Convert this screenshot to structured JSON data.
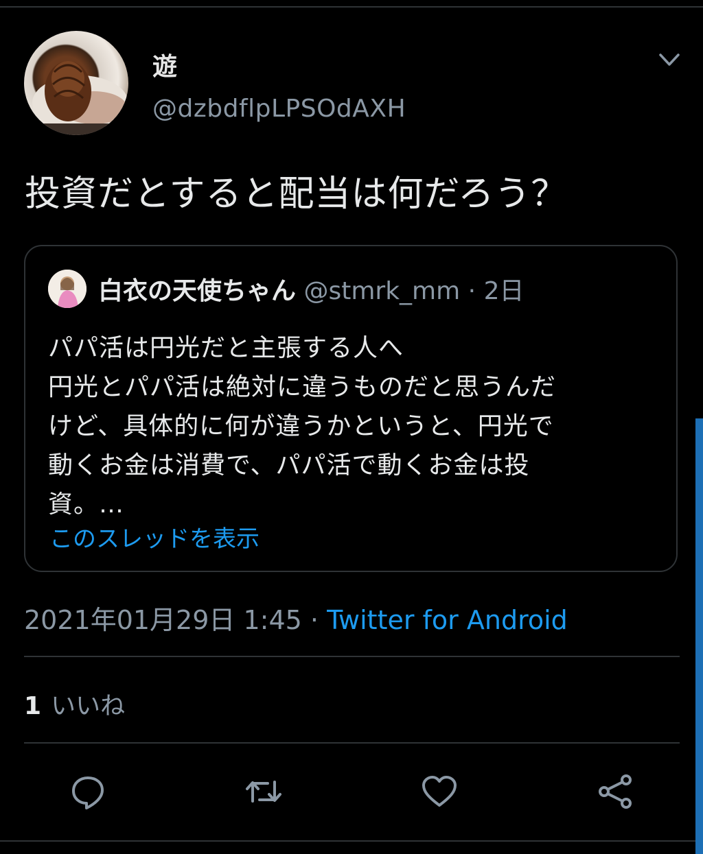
{
  "tweet": {
    "author": {
      "display_name": "遊",
      "handle": "@dzbdflpLPSOdAXH",
      "avatar_icon": "mont-blanc-cake-avatar"
    },
    "text": "投資だとすると配当は何だろう？",
    "quoted": {
      "author": {
        "display_name": "白衣の天使ちゃん",
        "handle": "@stmrk_mm",
        "avatar_icon": "user-photo-avatar"
      },
      "separator": "·",
      "age": "2日",
      "lines": [
        "パパ活は円光だと主張する人へ",
        "円光とパパ活は絶対に違うものだと思うんだ",
        "けど、具体的に何が違うかというと、円光で",
        "動くお金は消費で、パパ活で動くお金は投",
        "資。…"
      ],
      "show_thread_label": "このスレッドを表示"
    },
    "timestamp": "2021年01月29日 1:45",
    "meta_separator": "·",
    "source": "Twitter for Android",
    "likes": {
      "count": "1",
      "label": "いいね"
    }
  },
  "actions": [
    {
      "name": "reply",
      "icon": "reply-icon"
    },
    {
      "name": "retweet",
      "icon": "retweet-icon"
    },
    {
      "name": "like",
      "icon": "heart-icon"
    },
    {
      "name": "share",
      "icon": "share-icon"
    }
  ],
  "colors": {
    "background": "#000000",
    "text": "#e7e9ea",
    "secondary": "#8b98a5",
    "accent": "#1d9bf0",
    "divider": "#2f3336"
  }
}
